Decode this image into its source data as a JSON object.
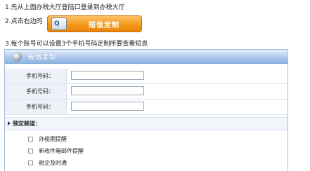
{
  "steps": {
    "step1": "1.先从上面办税大厅登陆口登录到办税大厅",
    "step2_prefix": "2.点击右边的",
    "step3": "3.每个账号可以设置3个手机号码定制所要查看短息"
  },
  "sms_button": {
    "icon": "Q",
    "label": "短信定制"
  },
  "panel": {
    "title": "短信定制",
    "rows": [
      {
        "label": "手机号码：",
        "value": ""
      },
      {
        "label": "手机号码：",
        "value": ""
      },
      {
        "label": "手机号码：",
        "value": ""
      }
    ],
    "section_label": "预定频道：",
    "channels": [
      {
        "label": "办税期提醒",
        "checked": false
      },
      {
        "label": "新收件箱邮件提醒",
        "checked": false
      },
      {
        "label": "税企及时通",
        "checked": false
      }
    ]
  },
  "colors": {
    "accent_orange": "#f39a1d",
    "panel_blue": "#a9c6ec"
  }
}
